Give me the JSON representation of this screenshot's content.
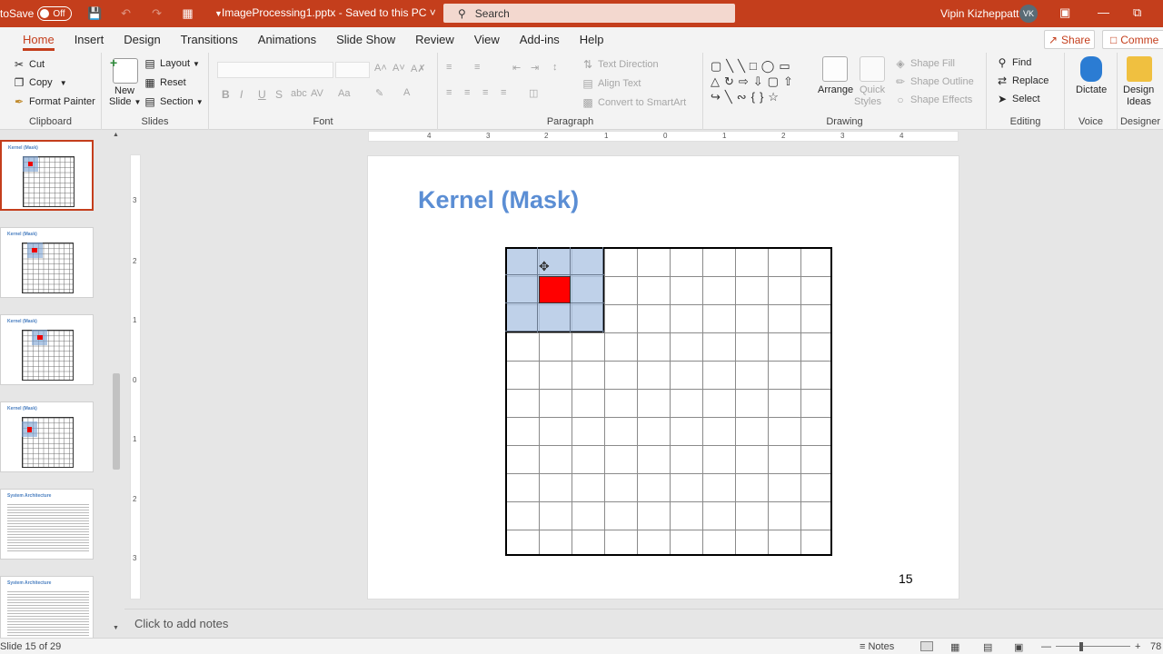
{
  "titlebar": {
    "autosave_label": "toSave",
    "toggle_state": "Off",
    "doc_title": "ImageProcessing1.pptx  -  Saved to this PC",
    "search_placeholder": "Search",
    "user_name": "Vipin Kizheppatt",
    "user_initials": "VK"
  },
  "tabs": [
    "Home",
    "Insert",
    "Design",
    "Transitions",
    "Animations",
    "Slide Show",
    "Review",
    "View",
    "Add-ins",
    "Help"
  ],
  "active_tab": "Home",
  "share_label": "Share",
  "comments_label": "Comme",
  "ribbon": {
    "clipboard": {
      "cut": "Cut",
      "copy": "Copy",
      "format_painter": "Format Painter",
      "label": "Clipboard"
    },
    "slides": {
      "new_slide_1": "New",
      "new_slide_2": "Slide",
      "layout": "Layout",
      "reset": "Reset",
      "section": "Section",
      "label": "Slides"
    },
    "font": {
      "label": "Font",
      "bold": "B",
      "italic": "I",
      "underline": "U",
      "shadow": "S",
      "spacing": "AV",
      "case": "Aa"
    },
    "paragraph": {
      "text_direction": "Text Direction",
      "align_text": "Align Text",
      "smartart": "Convert to SmartArt",
      "label": "Paragraph"
    },
    "drawing": {
      "arrange": "Arrange",
      "quick_styles_1": "Quick",
      "quick_styles_2": "Styles",
      "shape_fill": "Shape Fill",
      "shape_outline": "Shape Outline",
      "shape_effects": "Shape Effects",
      "label": "Drawing"
    },
    "editing": {
      "find": "Find",
      "replace": "Replace",
      "select": "Select",
      "label": "Editing"
    },
    "voice": {
      "dictate": "Dictate",
      "label": "Voice"
    },
    "designer": {
      "design_ideas_1": "Design",
      "design_ideas_2": "Ideas",
      "label": "Designer"
    }
  },
  "thumbnails": [
    {
      "title": "Kernel (Mask)"
    },
    {
      "title": "Kernel (Mask)"
    },
    {
      "title": "Kernel (Mask)"
    },
    {
      "title": "Kernel (Mask)"
    },
    {
      "title": "System Architecture"
    },
    {
      "title": "System Architecture"
    }
  ],
  "hruler_ticks": [
    "4",
    "3",
    "2",
    "1",
    "0",
    "1",
    "2",
    "3",
    "4"
  ],
  "vruler_ticks": [
    "3",
    "2",
    "1",
    "0",
    "1",
    "2",
    "3"
  ],
  "slide": {
    "title": "Kernel (Mask)",
    "page_number": "15"
  },
  "notes_placeholder": "Click to add notes",
  "status": {
    "slide_count": "15 of 29",
    "notes": "Notes",
    "zoom": "78"
  },
  "colors": {
    "accent": "#c43e1c",
    "title_blue": "#5b8ed4",
    "mask_blue": "#afc6e4",
    "kernel_center": "#ff0000"
  }
}
